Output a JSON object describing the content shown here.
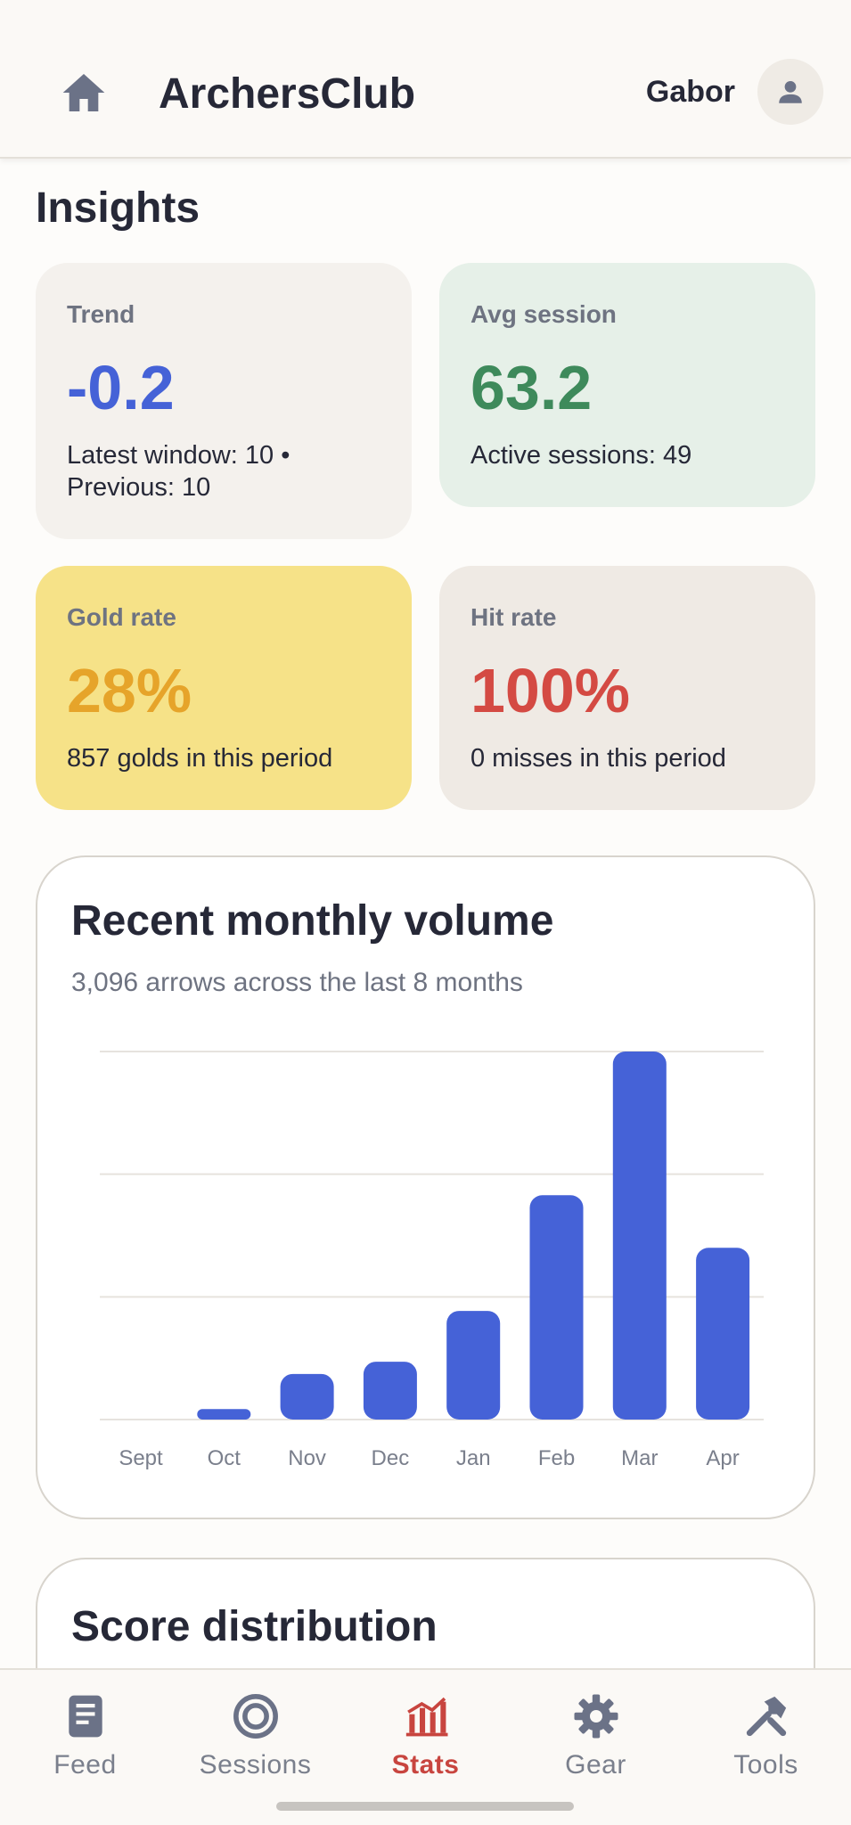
{
  "header": {
    "app_title": "ArchersClub",
    "user_name": "Gabor",
    "home_icon": "home-icon",
    "avatar_icon": "person-icon"
  },
  "page": {
    "title": "Insights"
  },
  "stats": {
    "trend": {
      "label": "Trend",
      "value": "-0.2",
      "sub": "Latest window: 10 • Previous: 10",
      "color": "#4562d7"
    },
    "avg_session": {
      "label": "Avg session",
      "value": "63.2",
      "sub": "Active sessions: 49",
      "color": "#3e8a5b"
    },
    "gold_rate": {
      "label": "Gold rate",
      "value": "28%",
      "sub": "857 golds in this period",
      "color": "#e6a42a"
    },
    "hit_rate": {
      "label": "Hit rate",
      "value": "100%",
      "sub": "0 misses in this period",
      "color": "#d44a43"
    }
  },
  "volume_card": {
    "title": "Recent monthly volume",
    "subtitle": "3,096 arrows across the last 8 months"
  },
  "chart_data": {
    "type": "bar",
    "categories": [
      "Sept",
      "Oct",
      "Nov",
      "Dec",
      "Jan",
      "Feb",
      "Mar",
      "Apr"
    ],
    "values": [
      0,
      30,
      130,
      165,
      310,
      640,
      1050,
      490
    ],
    "ylim": [
      0,
      1050
    ],
    "grid": true,
    "bar_color": "#4562d7"
  },
  "distribution_card": {
    "title": "Score distribution"
  },
  "bottom_nav": {
    "items": [
      {
        "label": "Feed",
        "icon": "feed-icon"
      },
      {
        "label": "Sessions",
        "icon": "target-icon"
      },
      {
        "label": "Stats",
        "icon": "bar-chart-icon",
        "active": true
      },
      {
        "label": "Gear",
        "icon": "gear-icon"
      },
      {
        "label": "Tools",
        "icon": "tools-icon"
      }
    ],
    "active_color": "#c8453f",
    "inactive_color": "#7a7f8c"
  }
}
